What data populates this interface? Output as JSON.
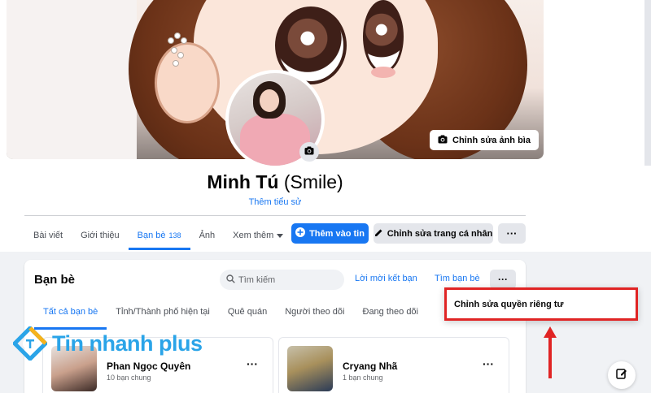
{
  "profile": {
    "name": "Minh Tú",
    "nickname": "(Smile)",
    "add_bio": "Thêm tiểu sử",
    "edit_cover_label": "Chỉnh sửa ảnh bìa"
  },
  "nav": {
    "items": [
      {
        "label": "Bài viết"
      },
      {
        "label": "Giới thiệu"
      },
      {
        "label": "Bạn bè",
        "count": "138"
      },
      {
        "label": "Ảnh"
      },
      {
        "label": "Xem thêm"
      }
    ],
    "active_index": 2,
    "add_story_label": "Thêm vào tin",
    "edit_profile_label": "Chỉnh sửa trang cá nhân",
    "more_label": "···"
  },
  "friends": {
    "title": "Bạn bè",
    "search_placeholder": "Tìm kiếm",
    "friend_requests_label": "Lời mời kết bạn",
    "find_friends_label": "Tìm bạn bè",
    "more_label": "···",
    "tabs": [
      {
        "label": "Tất cả bạn bè"
      },
      {
        "label": "Tỉnh/Thành phố hiện tại"
      },
      {
        "label": "Quê quán"
      },
      {
        "label": "Người theo dõi"
      },
      {
        "label": "Đang theo dõi"
      }
    ],
    "active_tab_index": 0,
    "list": [
      {
        "name": "Phan Ngọc Quyên",
        "mutual": "10 bạn chung",
        "more": "···"
      },
      {
        "name": "Cryang Nhã",
        "mutual": "1 bạn chung",
        "more": "···"
      }
    ]
  },
  "dropdown": {
    "item_label": "Chỉnh sửa quyền riêng tư"
  },
  "watermark": {
    "text": "Tin nhanh plus"
  },
  "colors": {
    "accent": "#1877f2",
    "highlight_border": "#e02424",
    "watermark": "#2aa4e8"
  }
}
